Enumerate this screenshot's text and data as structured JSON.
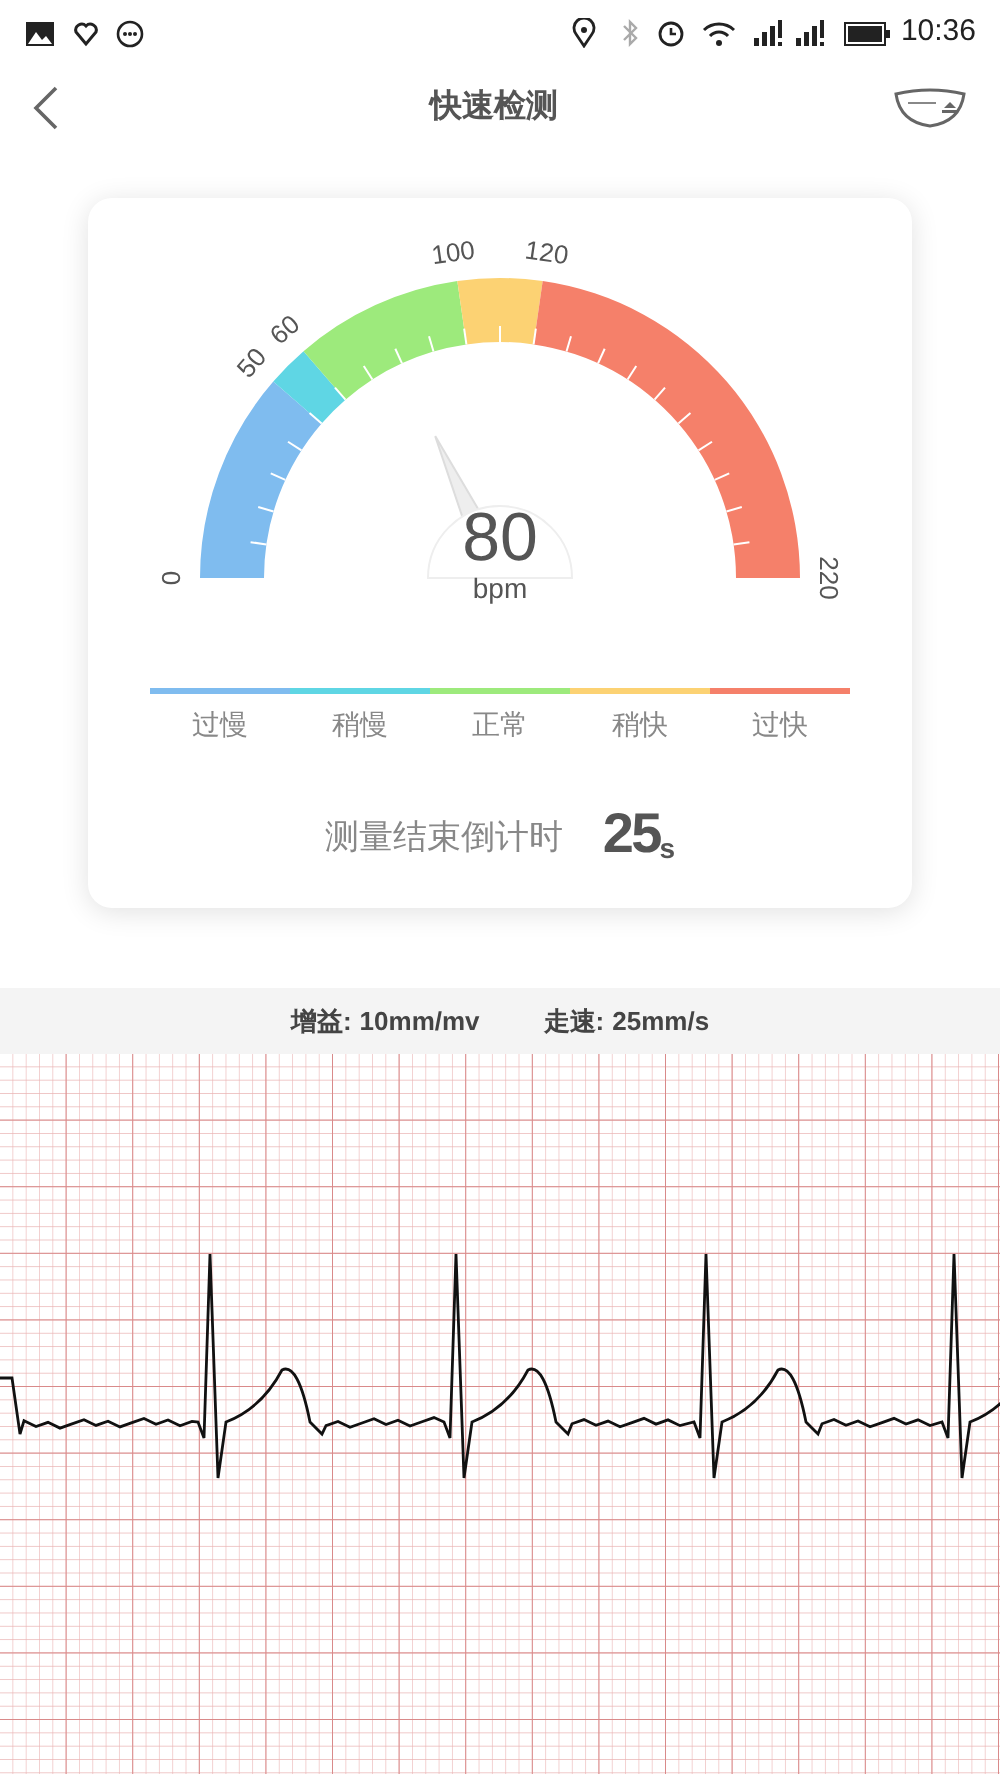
{
  "status_bar": {
    "time": "10:36"
  },
  "header": {
    "title": "快速检测"
  },
  "gauge": {
    "reading": "80",
    "unit": "bpm",
    "segments": [
      {
        "color": "#7fbcef"
      },
      {
        "color": "#5fd6e4"
      },
      {
        "color": "#9dea7c"
      },
      {
        "color": "#fcd273"
      },
      {
        "color": "#f5806a"
      }
    ],
    "scale_labels": [
      "0",
      "50",
      "60",
      "100",
      "120",
      "220"
    ]
  },
  "legend": [
    {
      "label": "过慢",
      "color": "#7fbcef"
    },
    {
      "label": "稍慢",
      "color": "#5fd6e4"
    },
    {
      "label": "正常",
      "color": "#9dea7c"
    },
    {
      "label": "稍快",
      "color": "#fcd273"
    },
    {
      "label": "过快",
      "color": "#f5806a"
    }
  ],
  "countdown": {
    "label": "测量结束倒计时",
    "value": "25",
    "unit": "s"
  },
  "ecg": {
    "gain_label": "增益:",
    "gain": "10mm/mv",
    "speed_label": "走速:",
    "speed": "25mm/s"
  }
}
